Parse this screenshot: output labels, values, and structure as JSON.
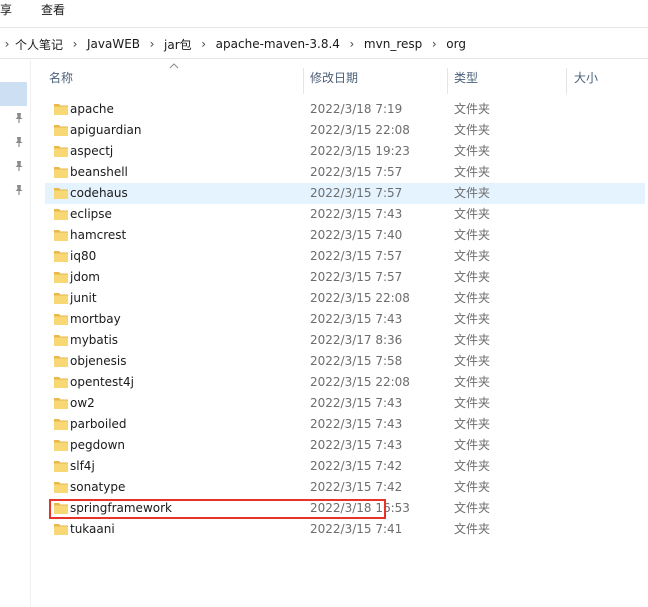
{
  "ribbon": {
    "share_label": "享",
    "view_label": "查看"
  },
  "breadcrumb": {
    "items": [
      "个人笔记",
      "JavaWEB",
      "jar包",
      "apache-maven-3.8.4",
      "mvn_resp",
      "org"
    ]
  },
  "columns": {
    "name": "名称",
    "date": "修改日期",
    "type": "类型",
    "size": "大小"
  },
  "files": [
    {
      "name": "apache",
      "date": "2022/3/18 7:19",
      "type": "文件夹"
    },
    {
      "name": "apiguardian",
      "date": "2022/3/15 22:08",
      "type": "文件夹"
    },
    {
      "name": "aspectj",
      "date": "2022/3/15 19:23",
      "type": "文件夹"
    },
    {
      "name": "beanshell",
      "date": "2022/3/15 7:57",
      "type": "文件夹"
    },
    {
      "name": "codehaus",
      "date": "2022/3/15 7:57",
      "type": "文件夹"
    },
    {
      "name": "eclipse",
      "date": "2022/3/15 7:43",
      "type": "文件夹"
    },
    {
      "name": "hamcrest",
      "date": "2022/3/15 7:40",
      "type": "文件夹"
    },
    {
      "name": "iq80",
      "date": "2022/3/15 7:57",
      "type": "文件夹"
    },
    {
      "name": "jdom",
      "date": "2022/3/15 7:57",
      "type": "文件夹"
    },
    {
      "name": "junit",
      "date": "2022/3/15 22:08",
      "type": "文件夹"
    },
    {
      "name": "mortbay",
      "date": "2022/3/15 7:43",
      "type": "文件夹"
    },
    {
      "name": "mybatis",
      "date": "2022/3/17 8:36",
      "type": "文件夹"
    },
    {
      "name": "objenesis",
      "date": "2022/3/15 7:58",
      "type": "文件夹"
    },
    {
      "name": "opentest4j",
      "date": "2022/3/15 22:08",
      "type": "文件夹"
    },
    {
      "name": "ow2",
      "date": "2022/3/15 7:43",
      "type": "文件夹"
    },
    {
      "name": "parboiled",
      "date": "2022/3/15 7:43",
      "type": "文件夹"
    },
    {
      "name": "pegdown",
      "date": "2022/3/15 7:43",
      "type": "文件夹"
    },
    {
      "name": "slf4j",
      "date": "2022/3/15 7:42",
      "type": "文件夹"
    },
    {
      "name": "sonatype",
      "date": "2022/3/15 7:42",
      "type": "文件夹"
    },
    {
      "name": "springframework",
      "date": "2022/3/18 16:53",
      "type": "文件夹"
    },
    {
      "name": "tukaani",
      "date": "2022/3/15 7:41",
      "type": "文件夹"
    }
  ],
  "hovered_row": 4,
  "highlighted_row": 19,
  "colors": {
    "hover": "#e5f3ff",
    "nav_selected": "#cde0f3",
    "highlight_box": "#e8332a",
    "folder": "#f8d775"
  },
  "icons": {
    "folder": "folder-icon",
    "pin": "pin-icon",
    "separator": "chevron-right-icon",
    "sort": "sort-up-icon"
  }
}
